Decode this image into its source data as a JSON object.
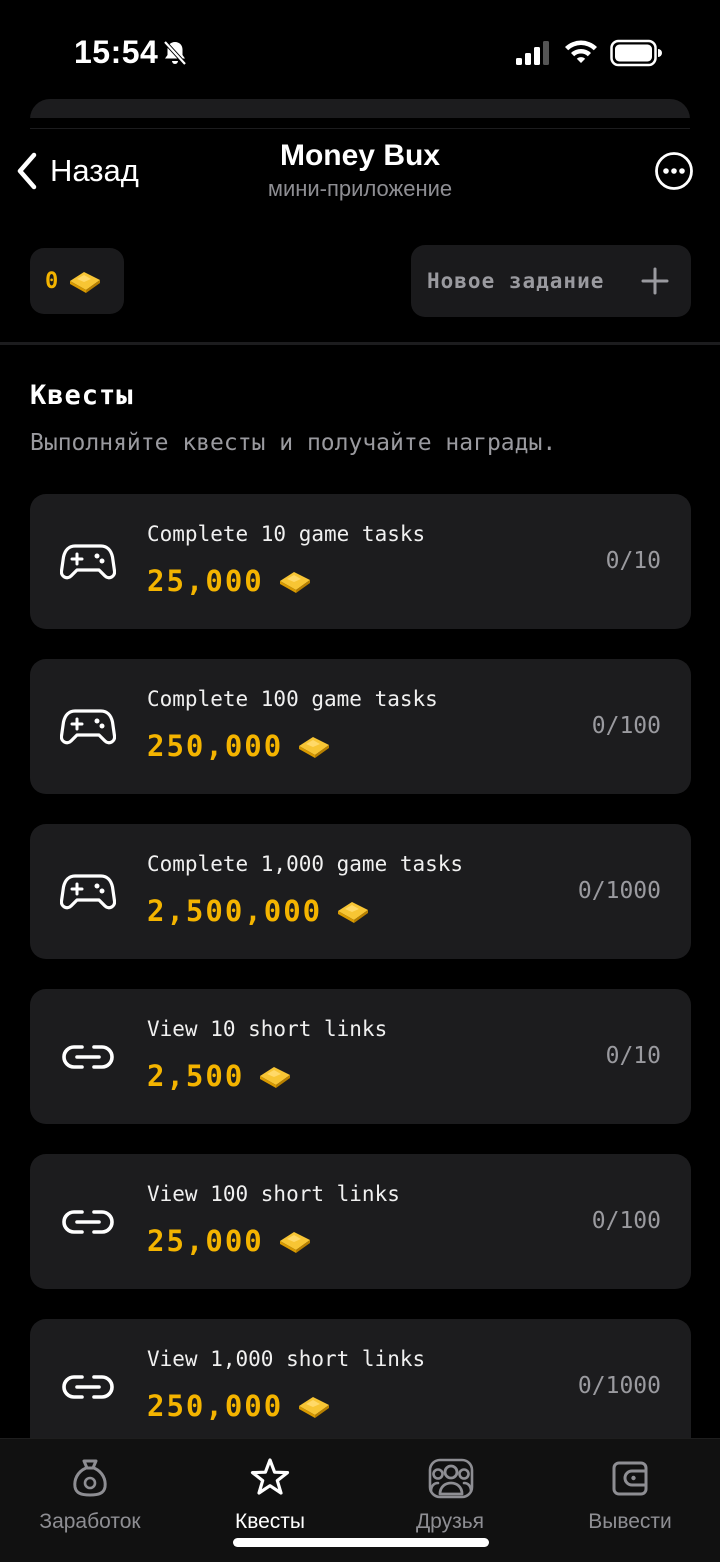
{
  "status_bar": {
    "time": "15:54"
  },
  "nav": {
    "back_label": "Назад",
    "title": "Money Bux",
    "subtitle": "мини-приложение"
  },
  "balance": {
    "value": "0"
  },
  "new_task": {
    "label": "Новое задание"
  },
  "section": {
    "title": "Квесты",
    "description": "Выполняйте квесты и получайте награды."
  },
  "quests": [
    {
      "title": "Complete 10 game tasks",
      "reward": "25,000",
      "progress": "0/10",
      "icon": "gamepad-icon"
    },
    {
      "title": "Complete 100 game tasks",
      "reward": "250,000",
      "progress": "0/100",
      "icon": "gamepad-icon"
    },
    {
      "title": "Complete 1,000 game tasks",
      "reward": "2,500,000",
      "progress": "0/1000",
      "icon": "gamepad-icon"
    },
    {
      "title": "View 10 short links",
      "reward": "2,500",
      "progress": "0/10",
      "icon": "link-icon"
    },
    {
      "title": "View 100 short links",
      "reward": "25,000",
      "progress": "0/100",
      "icon": "link-icon"
    },
    {
      "title": "View 1,000 short links",
      "reward": "250,000",
      "progress": "0/1000",
      "icon": "link-icon"
    }
  ],
  "tabs": [
    {
      "label": "Заработок",
      "icon": "money-bag-icon",
      "active": false
    },
    {
      "label": "Квесты",
      "icon": "star-icon",
      "active": true
    },
    {
      "label": "Друзья",
      "icon": "friends-icon",
      "active": false
    },
    {
      "label": "Вывести",
      "icon": "wallet-icon",
      "active": false
    }
  ],
  "colors": {
    "accent_gold": "#f4b400",
    "card_bg": "#1c1c1e",
    "background": "#000000",
    "muted_text": "#9a9a9f"
  }
}
